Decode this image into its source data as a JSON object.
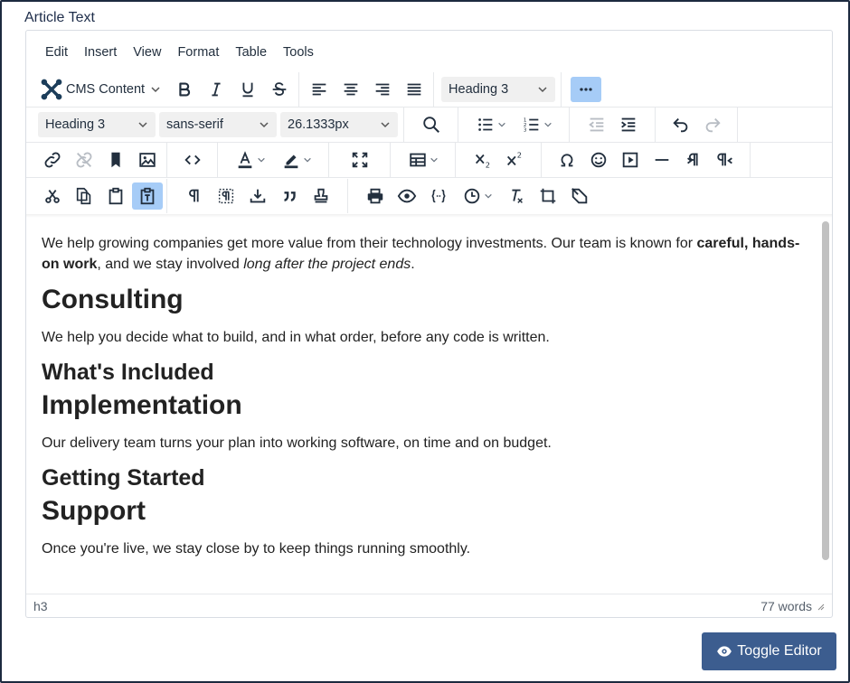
{
  "field_label": "Article Text",
  "menubar": [
    "Edit",
    "Insert",
    "View",
    "Format",
    "Table",
    "Tools"
  ],
  "toolbar": {
    "cms_content_label": "CMS Content",
    "block_format_1": "Heading 3",
    "block_format_2": "Heading 3",
    "font_family": "sans-serif",
    "font_size": "26.1333px"
  },
  "content": {
    "intro_a": "We help growing companies get more value from their technology investments. Our team is known for ",
    "intro_bold": "careful, hands-on work",
    "intro_b": ", and we stay involved ",
    "intro_italic": "long after the project ends",
    "intro_c": ".",
    "h_consulting": "Consulting",
    "p_consulting": "We help you decide what to build, and in what order, before any code is written.",
    "h_included": "What's Included",
    "h_implementation": "Implementation",
    "p_implementation": "Our delivery team turns your plan into working software, on time and on budget.",
    "h_started": "Getting Started",
    "h_support": "Support",
    "p_support": "Once you're live, we stay close by to keep things running smoothly."
  },
  "status": {
    "path": "h3",
    "word_count": "77 words"
  },
  "toggle_button": "Toggle Editor",
  "colors": {
    "accent_active": "#a6ccf7",
    "toggle_button_bg": "#3c5d8f",
    "text": "#222f3e"
  }
}
